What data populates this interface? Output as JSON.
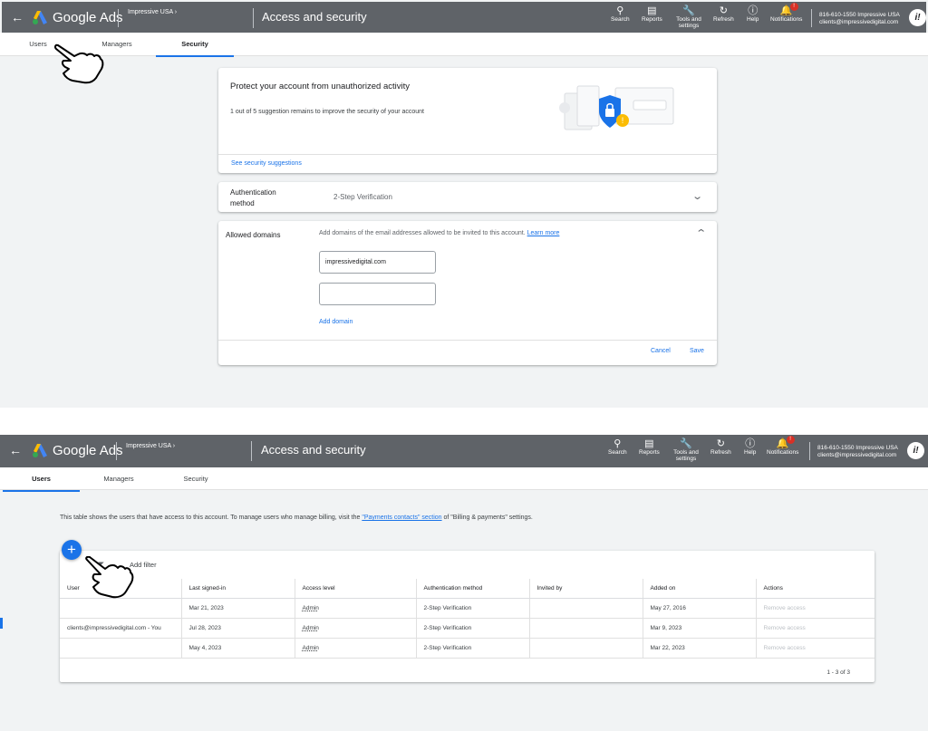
{
  "colors": {
    "accent": "#1a73e8",
    "topbar": "#5f6368",
    "badge": "#d93025",
    "background": "#f1f3f4"
  },
  "header": {
    "product": "Google Ads",
    "account_top": "Impressive USA",
    "account_bottom": "Impressive USA",
    "page_title": "Access and security",
    "tools": [
      {
        "label": "Search",
        "icon": "search-icon"
      },
      {
        "label": "Reports",
        "icon": "reports-icon"
      },
      {
        "label": "Tools and settings",
        "icon": "wrench-icon"
      },
      {
        "label": "Refresh",
        "icon": "refresh-icon"
      },
      {
        "label": "Help",
        "icon": "help-icon"
      },
      {
        "label": "Notifications",
        "icon": "bell-icon"
      }
    ],
    "notification_badge": "!",
    "user_line1": "816-610-1550 Impressive USA",
    "user_line2": "clients@impressivedigital.com"
  },
  "tabs": {
    "users": "Users",
    "managers": "Managers",
    "security": "Security"
  },
  "security": {
    "protect_title": "Protect your account from unauthorized activity",
    "protect_body": "1 out of 5 suggestion remains to improve the security of your account",
    "see_suggestions": "See security suggestions",
    "auth_label_1": "Authentication",
    "auth_label_2": "method",
    "auth_value": "2-Step Verification",
    "allowed_label": "Allowed domains",
    "allowed_desc": "Add domains of the email addresses allowed to be invited to this account.",
    "learn_more": "Learn more",
    "domain_value": "impressivedigital.com",
    "domain_placeholder": "",
    "add_domain": "Add domain",
    "cancel": "Cancel",
    "save": "Save"
  },
  "users": {
    "intro_pre": "This table shows the users that have access to this account. To manage users who manage billing, visit the ",
    "intro_link": "\"Payments contacts\" section",
    "intro_post": " of \"Billing & payments\" settings.",
    "add_filter": "Add filter",
    "columns": [
      "User",
      "Last signed-in",
      "Access level",
      "Authentication method",
      "Invited by",
      "Added on",
      "Actions"
    ],
    "rows": [
      {
        "user": "",
        "last": "Mar 21, 2023",
        "access": "Admin",
        "auth": "2-Step Verification",
        "invited": "",
        "added": "May 27, 2016",
        "action": "Remove access"
      },
      {
        "user": "clients@impressivedigital.com - You",
        "last": "Jul 28, 2023",
        "access": "Admin",
        "auth": "2-Step Verification",
        "invited": "",
        "added": "Mar 9, 2023",
        "action": "Remove access"
      },
      {
        "user": "",
        "last": "May 4, 2023",
        "access": "Admin",
        "auth": "2-Step Verification",
        "invited": "",
        "added": "Mar 22, 2023",
        "action": "Remove access"
      }
    ],
    "pagination": "1 - 3 of 3"
  }
}
